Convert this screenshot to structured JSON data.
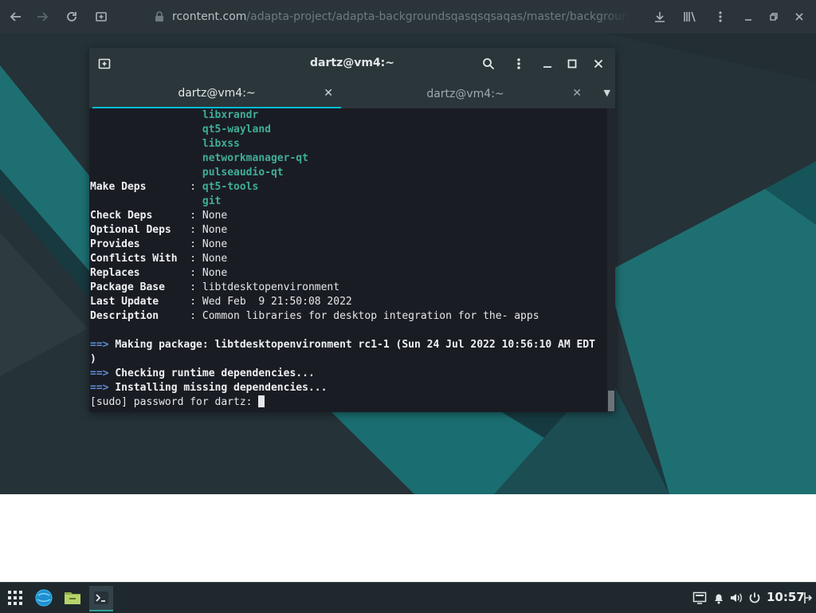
{
  "browser": {
    "url_host": "rcontent.com",
    "url_path": "/adapta-project/adapta-backgroundsqasqsqsaqas/master/backgrounds"
  },
  "terminal": {
    "title": "dartz@vm4:~",
    "tabs": [
      {
        "label": "dartz@vm4:~",
        "active": true
      },
      {
        "label": "dartz@vm4:~",
        "active": false
      }
    ],
    "lines": [
      {
        "key": "",
        "sep": "",
        "value": "libxrandr",
        "style": "dep"
      },
      {
        "key": "",
        "sep": "",
        "value": "qt5-wayland",
        "style": "dep"
      },
      {
        "key": "",
        "sep": "",
        "value": "libxss",
        "style": "dep"
      },
      {
        "key": "",
        "sep": "",
        "value": "networkmanager-qt",
        "style": "dep"
      },
      {
        "key": "",
        "sep": "",
        "value": "pulseaudio-qt",
        "style": "dep"
      },
      {
        "key": "Make Deps",
        "sep": ":",
        "value": "qt5-tools",
        "style": "dep"
      },
      {
        "key": "",
        "sep": "",
        "value": "git",
        "style": "dep"
      },
      {
        "key": "Check Deps",
        "sep": ":",
        "value": "None",
        "style": "plain"
      },
      {
        "key": "Optional Deps",
        "sep": ":",
        "value": "None",
        "style": "plain"
      },
      {
        "key": "Provides",
        "sep": ":",
        "value": "None",
        "style": "plain"
      },
      {
        "key": "Conflicts With",
        "sep": ":",
        "value": "None",
        "style": "plain"
      },
      {
        "key": "Replaces",
        "sep": ":",
        "value": "None",
        "style": "plain"
      },
      {
        "key": "Package Base",
        "sep": ":",
        "value": "libtdesktopenvironment",
        "style": "plain"
      },
      {
        "key": "Last Update",
        "sep": ":",
        "value": "Wed Feb  9 21:50:08 2022",
        "style": "plain"
      },
      {
        "key": "Description",
        "sep": ":",
        "value": "Common libraries for desktop integration for the- apps",
        "style": "plain"
      }
    ],
    "messages": [
      {
        "arrow": "==>",
        "text": "Making package: libtdesktopenvironment rc1-1 (Sun 24 Jul 2022 10:56:10 AM EDT"
      },
      {
        "arrow": "",
        "text": ")"
      },
      {
        "arrow": "==>",
        "text": "Checking runtime dependencies..."
      },
      {
        "arrow": "==>",
        "text": "Installing missing dependencies..."
      }
    ],
    "prompt": "[sudo] password for dartz: "
  },
  "taskbar": {
    "clock": "10:57",
    "apps": [
      "app-launcher-icon",
      "browser-icon",
      "file-manager-icon",
      "terminal-icon"
    ]
  },
  "colors": {
    "accent": "#00bcd4",
    "dep_text": "#3fae96",
    "arrow": "#5b8fd6",
    "wallpaper": "#253237"
  }
}
